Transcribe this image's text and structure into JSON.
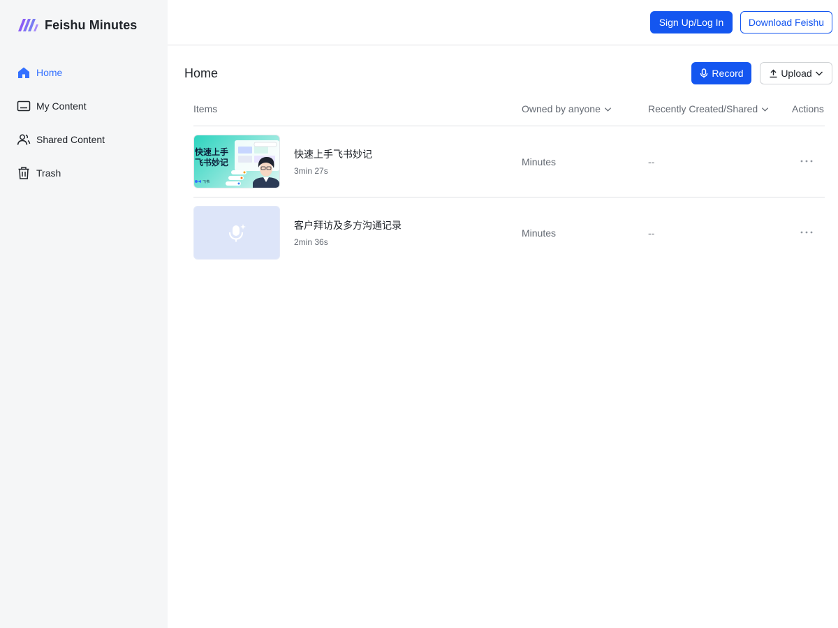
{
  "app": {
    "name": "Feishu Minutes"
  },
  "sidebar": {
    "items": [
      {
        "label": "Home",
        "icon": "home-icon",
        "active": true
      },
      {
        "label": "My Content",
        "icon": "folder-icon",
        "active": false
      },
      {
        "label": "Shared Content",
        "icon": "users-icon",
        "active": false
      },
      {
        "label": "Trash",
        "icon": "trash-icon",
        "active": false
      }
    ]
  },
  "header": {
    "signup_label": "Sign Up/Log In",
    "download_label": "Download Feishu"
  },
  "main": {
    "title": "Home",
    "record_label": "Record",
    "upload_label": "Upload",
    "columns": {
      "items": "Items",
      "owner": "Owned by anyone",
      "recent": "Recently Created/Shared",
      "actions": "Actions"
    },
    "rows": [
      {
        "thumbnail_text": "快速上手\n飞书妙记",
        "title": "快速上手飞书妙记",
        "duration": "3min 27s",
        "type": "Minutes",
        "recent": "--"
      },
      {
        "thumbnail_icon": "microphone-icon",
        "title": "客户拜访及多方沟通记录",
        "duration": "2min 36s",
        "type": "Minutes",
        "recent": "--"
      }
    ]
  },
  "colors": {
    "accent": "#3370ff",
    "primary_button": "#1456f0",
    "sidebar_bg": "#f5f6f7",
    "text": "#1f2329",
    "muted_text": "#646a73"
  }
}
